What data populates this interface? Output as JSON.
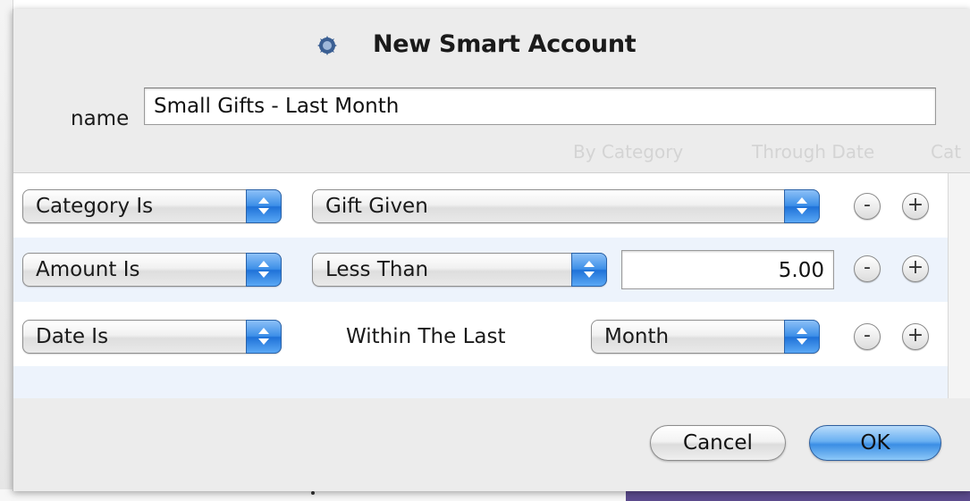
{
  "dialog": {
    "title": "New Smart Account",
    "name_label": "name",
    "name_value": "Small Gifts - Last Month"
  },
  "background_headers": [
    "By Category",
    "Through Date",
    "Cat"
  ],
  "rules": [
    {
      "field": "Category Is",
      "operator": "Gift Given",
      "value": null
    },
    {
      "field": "Amount Is",
      "operator": "Less Than",
      "value": "5.00"
    },
    {
      "field": "Date Is",
      "static_text": "Within The Last",
      "unit": "Month"
    }
  ],
  "rule_buttons": {
    "remove": "-",
    "add": "+"
  },
  "buttons": {
    "cancel": "Cancel",
    "ok": "OK"
  },
  "colors": {
    "accent": "#3d8fe8",
    "alt_row": "#edf3fc"
  }
}
